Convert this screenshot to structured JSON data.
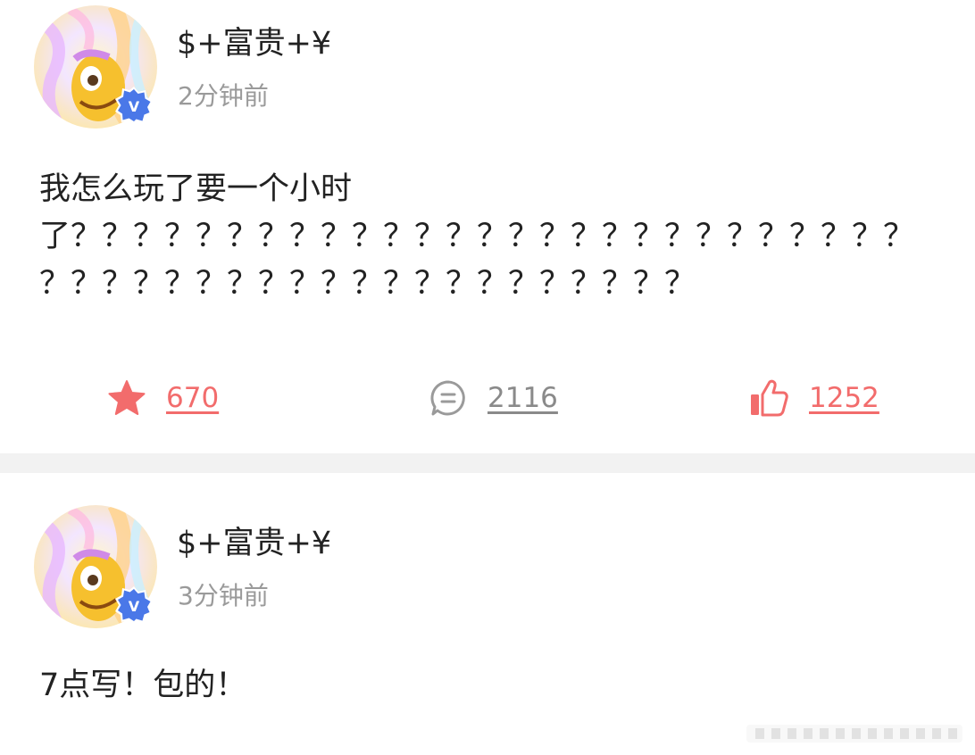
{
  "colors": {
    "accent": "#f26c6c",
    "comment_icon": "#9a9a9a",
    "comment_count": "#8a8a8a",
    "badge": "#4a78e8",
    "separator": "#f2f2f2"
  },
  "posts": [
    {
      "username": "$+富贵+¥",
      "timestamp": "2分钟前",
      "text": "我怎么玩了要一个小时了？？？？？？？？？？？？？？？？？？？？？？？？？？？？？？？？？？？？？？？？？？？？？？？？",
      "verified_badge_letter": "V",
      "actions": {
        "favorite_icon": "star-icon",
        "favorite_count": "670",
        "comment_icon": "comment-bubble-icon",
        "comment_count": "2116",
        "like_icon": "thumbs-up-icon",
        "like_count": "1252"
      }
    },
    {
      "username": "$+富贵+¥",
      "timestamp": "3分钟前",
      "text": "7点写！包的！",
      "verified_badge_letter": "V"
    }
  ]
}
